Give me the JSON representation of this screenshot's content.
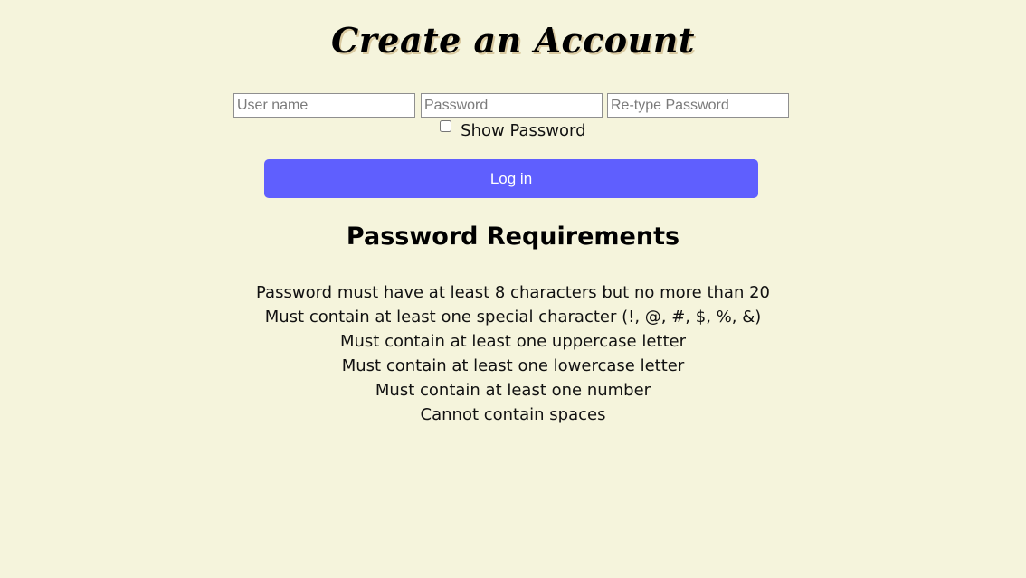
{
  "page": {
    "title": "Create an Account"
  },
  "form": {
    "username_placeholder": "User name",
    "username_value": "",
    "password_placeholder": "Password",
    "password_value": "",
    "retype_placeholder": "Re-type Password",
    "retype_value": "",
    "show_password_label": "Show Password",
    "show_password_checked": false,
    "login_label": "Log in"
  },
  "requirements": {
    "heading": "Password Requirements",
    "items": [
      "Password must have at least 8 characters but no more than 20",
      "Must contain at least one special character (!, @, #, $, %, &)",
      "Must contain at least one uppercase letter",
      "Must contain at least one lowercase letter",
      "Must contain at least one number",
      "Cannot contain spaces"
    ]
  },
  "colors": {
    "background": "#f5f4dc",
    "button": "#5f5ffe",
    "button_text": "#ffffff"
  }
}
